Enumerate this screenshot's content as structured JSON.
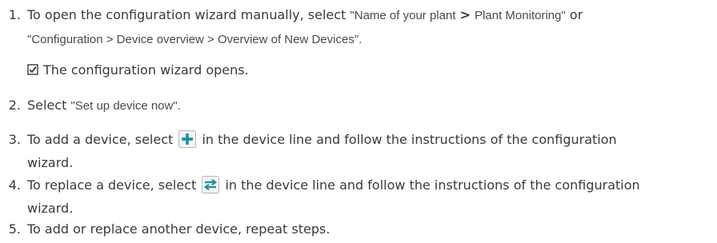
{
  "steps": [
    {
      "number": "1.",
      "line1_a": "To open the configuration wizard manually, select",
      "line1_q1": "\"",
      "line1_path1": "Name of your plant",
      "line1_sep": ">",
      "line1_path2": "Plant Monitoring",
      "line1_q2": "\"",
      "line1_or": "or",
      "line2_q1": "\"",
      "line2_path": "Configuration > Device overview > Overview of New Devices",
      "line2_q2": "\".",
      "result": "The configuration wizard opens."
    },
    {
      "number": "2.",
      "text_a": "Select",
      "q1": "\"",
      "ui": "Set up device now",
      "q2": "\"."
    },
    {
      "number": "3.",
      "text_a": "To add a device, select",
      "icon": "plus-icon",
      "text_b": "in the device line and follow the instructions of the configuration",
      "line2": "wizard."
    },
    {
      "number": "4.",
      "text_a": "To replace a device, select",
      "icon": "swap-arrows-icon",
      "text_b": "in the device line and follow the instructions of the configuration",
      "line2": "wizard."
    },
    {
      "number": "5.",
      "text_a": "To add or replace another device, repeat steps."
    }
  ],
  "colors": {
    "text": "#3a3a3a",
    "icon_border": "#b8b8b8",
    "icon_fill": "#1a8fa0"
  }
}
